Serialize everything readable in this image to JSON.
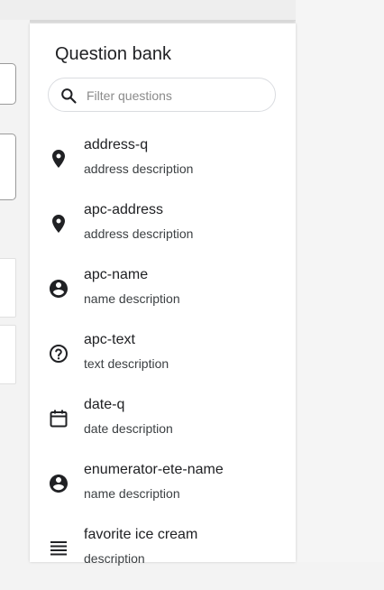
{
  "panel": {
    "title": "Question bank",
    "search": {
      "placeholder": "Filter questions",
      "value": "",
      "icon": "search-icon"
    }
  },
  "questions": [
    {
      "name": "address-q",
      "description": "address description",
      "icon": "location-pin-icon"
    },
    {
      "name": "apc-address",
      "description": "address description",
      "icon": "location-pin-icon"
    },
    {
      "name": "apc-name",
      "description": "name description",
      "icon": "account-circle-icon"
    },
    {
      "name": "apc-text",
      "description": "text description",
      "icon": "help-circle-icon"
    },
    {
      "name": "date-q",
      "description": "date description",
      "icon": "calendar-icon"
    },
    {
      "name": "enumerator-ete-name",
      "description": "name description",
      "icon": "account-circle-icon"
    },
    {
      "name": "favorite ice cream",
      "description": "description",
      "icon": "list-lines-icon"
    }
  ]
}
